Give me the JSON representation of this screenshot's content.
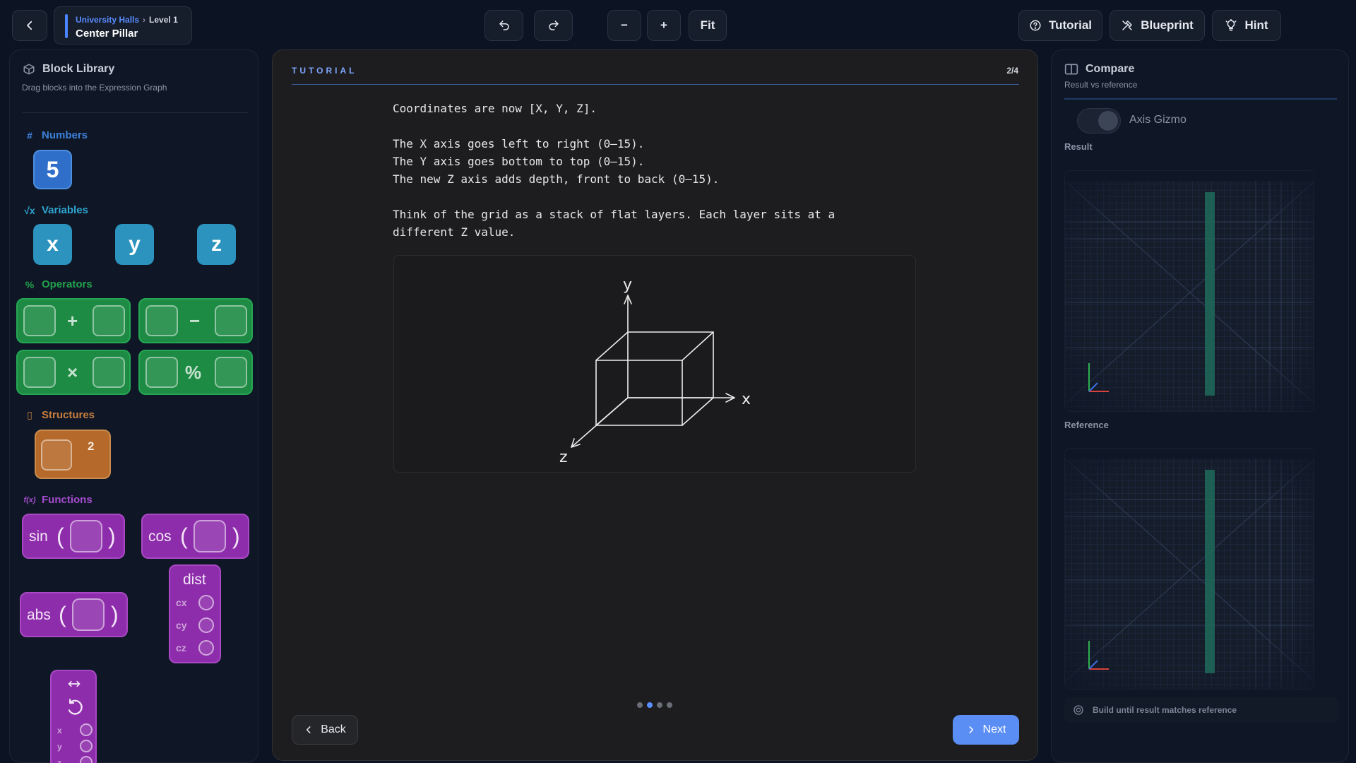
{
  "breadcrumb": {
    "parent": "University Halls",
    "level": "Level 1",
    "title": "Center Pillar"
  },
  "toolbar": {
    "zoom_out": "−",
    "zoom_in": "+",
    "fit": "Fit",
    "tutorial": "Tutorial",
    "blueprint": "Blueprint",
    "hint": "Hint"
  },
  "library": {
    "title": "Block Library",
    "subtitle": "Drag blocks into the Expression Graph",
    "sections": {
      "numbers": "Numbers",
      "variables": "Variables",
      "operators": "Operators",
      "structures": "Structures",
      "functions": "Functions"
    },
    "number_value": "5",
    "variables": [
      "x",
      "y",
      "z"
    ],
    "operators": [
      "+",
      "−",
      "×",
      "%"
    ],
    "power_exponent": "2",
    "functions": {
      "sin": "sin",
      "cos": "cos",
      "abs": "abs",
      "dist": "dist",
      "dist_params": [
        "cx",
        "cy",
        "cz"
      ],
      "rotate_params": [
        "x",
        "y",
        "z"
      ]
    }
  },
  "tutorial": {
    "label": "TUTORIAL",
    "page": "2/4",
    "lines": [
      "Coordinates are now [X, Y, Z].",
      "",
      "The X axis goes left to right (0–15).",
      "The Y axis goes bottom to top (0–15).",
      "The new Z axis adds depth, front to back (0–15).",
      "",
      "Think of the grid as a stack of flat layers. Each layer sits at a",
      "different Z value."
    ],
    "axis_labels": {
      "x": "x",
      "y": "y",
      "z": "z"
    },
    "back": "Back",
    "next": "Next",
    "step_total": 4,
    "step_current": 2
  },
  "compare": {
    "title": "Compare",
    "subtitle": "Result vs reference",
    "axis_gizmo": "Axis Gizmo",
    "result_label": "Result",
    "reference_label": "Reference",
    "status": "Build until result matches reference"
  },
  "colors": {
    "accent": "#5b8ef5",
    "numbers": "#2f6fc9",
    "variables": "#2b93bd",
    "operators": "#1d8b43",
    "structures": "#b5692a",
    "functions": "#8e2dab"
  }
}
